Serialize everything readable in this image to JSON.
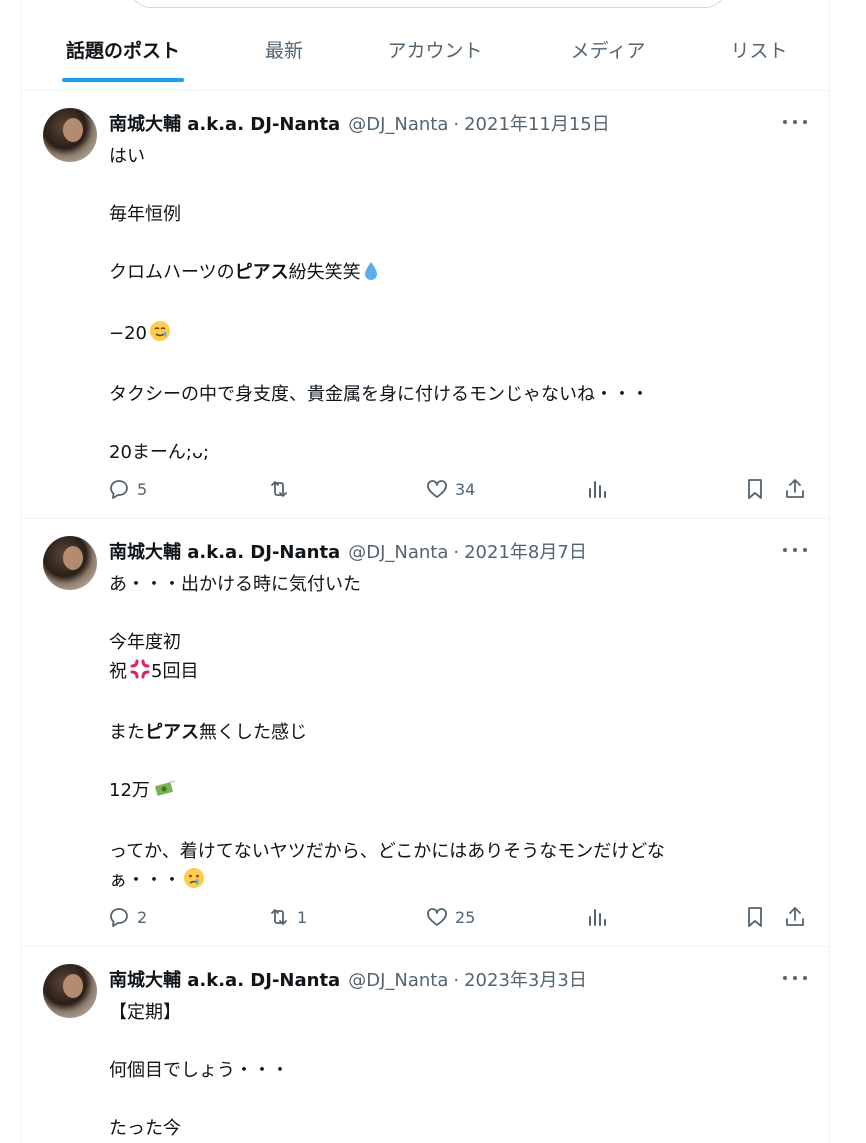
{
  "tabs": [
    {
      "label": "話題のポスト",
      "active": true
    },
    {
      "label": "最新"
    },
    {
      "label": "アカウント"
    },
    {
      "label": "メディア"
    },
    {
      "label": "リスト"
    }
  ],
  "tweets": [
    {
      "name": "南城大輔 a.k.a. DJ-Nanta",
      "handle": "@DJ_Nanta",
      "separator": "·",
      "date": "2021年11月15日",
      "lines": [
        "はい",
        "",
        "毎年恒例",
        "",
        "クロムハーツの|ピアス|紛失笑笑",
        "",
        "−20",
        "",
        "タクシーの中で身支度、貴金属を身に付けるモンじゃないね・・・",
        "",
        "20まーん;ᴗ;"
      ],
      "replies": "5",
      "retweets": "",
      "likes": "34"
    },
    {
      "name": "南城大輔 a.k.a. DJ-Nanta",
      "handle": "@DJ_Nanta",
      "separator": "·",
      "date": "2021年8月7日",
      "lines": [
        "あ・・・出かける時に気付いた",
        "",
        "今年度初",
        "祝",
        "",
        "また|ピアス|無くした感じ",
        "",
        "12万",
        "",
        "ってか、着けてないヤツだから、どこかにはありそうなモンだけどな",
        "ぁ・・・"
      ],
      "replies": "2",
      "retweets": "1",
      "likes": "25"
    },
    {
      "name": "南城大輔 a.k.a. DJ-Nanta",
      "handle": "@DJ_Nanta",
      "separator": "·",
      "date": "2023年3月3日",
      "lines": [
        "【定期】",
        "",
        "何個目でしょう・・・",
        "",
        "たった今"
      ],
      "replies": "",
      "retweets": "",
      "likes": ""
    }
  ],
  "line_parts": {
    "t0_l4_pre": "クロムハーツの",
    "t0_l4_bold": "ピアス",
    "t0_l4_post": "紛失笑笑",
    "t0_l6": "−20",
    "t1_l3_pre": "祝",
    "t1_l3_post": "5回目",
    "t1_l5_pre": "また",
    "t1_l5_bold": "ピアス",
    "t1_l5_post": "無くした感じ",
    "t1_l7": "12万",
    "t1_l10": "ぁ・・・"
  },
  "colors": {
    "accent": "#1d9bf0",
    "muted": "#536471",
    "text": "#0f1419"
  },
  "icons": [
    "reply-icon",
    "retweet-icon",
    "like-icon",
    "views-icon",
    "bookmark-icon",
    "share-icon",
    "more-icon"
  ]
}
